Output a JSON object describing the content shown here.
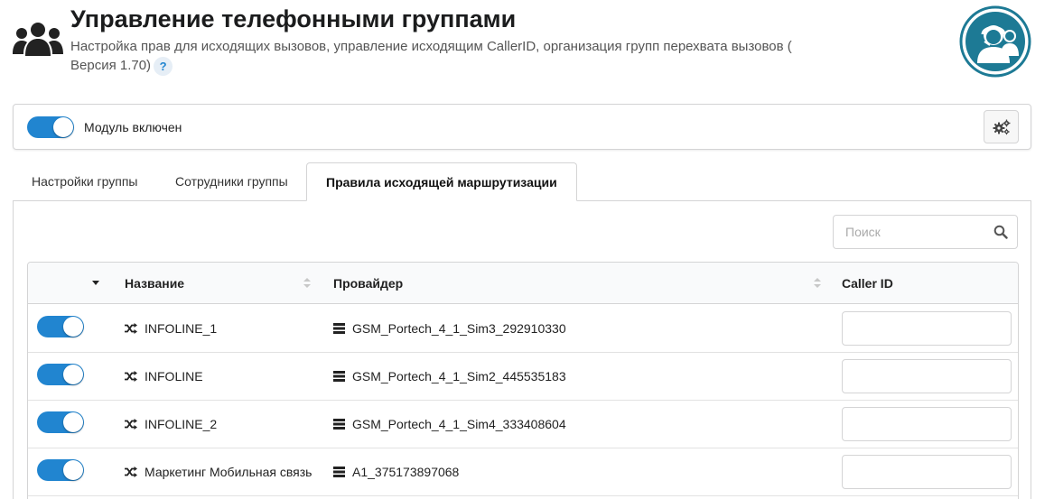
{
  "header": {
    "icon": "users-icon",
    "title": "Управление телефонными группами",
    "subtitle": "Настройка прав для исходящих вызовов, управление исходящим CallerID, организация групп перехвата вызовов ( Версия 1.70)",
    "help_label": "?",
    "logo_icon": "call-center-operators-logo"
  },
  "module": {
    "enabled": true,
    "label": "Модуль включен",
    "settings_icon": "gears-icon"
  },
  "tabs": [
    {
      "label": "Настройки группы",
      "active": false
    },
    {
      "label": "Сотрудники группы",
      "active": false
    },
    {
      "label": "Правила исходящей маршрутизации",
      "active": true
    }
  ],
  "search": {
    "placeholder": "Поиск",
    "value": ""
  },
  "table": {
    "columns": [
      "Название",
      "Провайдер",
      "Caller ID"
    ],
    "rows": [
      {
        "enabled": true,
        "name": "INFOLINE_1",
        "provider": "GSM_Portech_4_1_Sim3_292910330",
        "caller_id": ""
      },
      {
        "enabled": true,
        "name": "INFOLINE",
        "provider": "GSM_Portech_4_1_Sim2_445535183",
        "caller_id": ""
      },
      {
        "enabled": true,
        "name": "INFOLINE_2",
        "provider": "GSM_Portech_4_1_Sim4_333408604",
        "caller_id": ""
      },
      {
        "enabled": true,
        "name": "Маркетинг Мобильная связь",
        "provider": "A1_375173897068",
        "caller_id": ""
      }
    ]
  },
  "colors": {
    "accent": "#2185d0",
    "border": "#d4d4d5",
    "header_bg": "#f9fafb",
    "logo_teal": "#1d7a95"
  }
}
